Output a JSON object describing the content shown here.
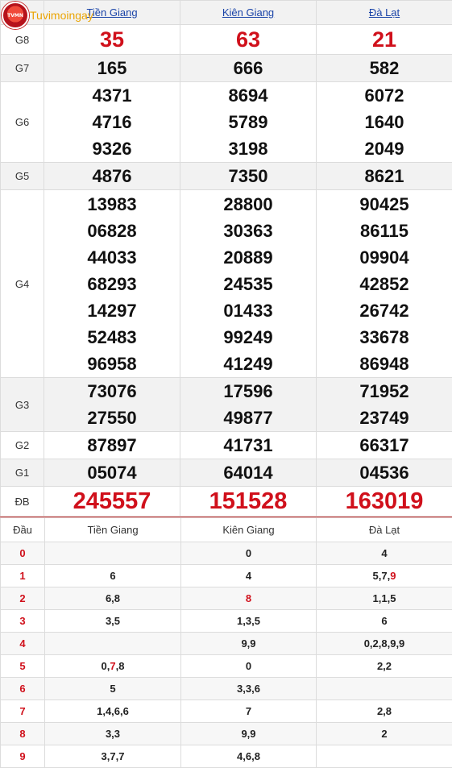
{
  "logo": {
    "text": "Tuvimoingay",
    "badge": "TVMN"
  },
  "results": {
    "provinces": [
      "Tiền Giang",
      "Kiên Giang",
      "Đà Lạt"
    ],
    "rows": [
      {
        "label": "G8",
        "values": [
          [
            "35"
          ],
          [
            "63"
          ],
          [
            "21"
          ]
        ]
      },
      {
        "label": "G7",
        "values": [
          [
            "165"
          ],
          [
            "666"
          ],
          [
            "582"
          ]
        ]
      },
      {
        "label": "G6",
        "values": [
          [
            "4371",
            "4716",
            "9326"
          ],
          [
            "8694",
            "5789",
            "3198"
          ],
          [
            "6072",
            "1640",
            "2049"
          ]
        ]
      },
      {
        "label": "G5",
        "values": [
          [
            "4876"
          ],
          [
            "7350"
          ],
          [
            "8621"
          ]
        ]
      },
      {
        "label": "G4",
        "values": [
          [
            "13983",
            "06828",
            "44033",
            "68293",
            "14297",
            "52483",
            "96958"
          ],
          [
            "28800",
            "30363",
            "20889",
            "24535",
            "01433",
            "99249",
            "41249"
          ],
          [
            "90425",
            "86115",
            "09904",
            "42852",
            "26742",
            "33678",
            "86948"
          ]
        ]
      },
      {
        "label": "G3",
        "values": [
          [
            "73076",
            "27550"
          ],
          [
            "17596",
            "49877"
          ],
          [
            "71952",
            "23749"
          ]
        ]
      },
      {
        "label": "G2",
        "values": [
          [
            "87897"
          ],
          [
            "41731"
          ],
          [
            "66317"
          ]
        ]
      },
      {
        "label": "G1",
        "values": [
          [
            "05074"
          ],
          [
            "64014"
          ],
          [
            "04536"
          ]
        ]
      },
      {
        "label": "ĐB",
        "values": [
          [
            "245557"
          ],
          [
            "151528"
          ],
          [
            "163019"
          ]
        ]
      }
    ]
  },
  "loto": {
    "header": [
      "Đầu",
      "Tiền Giang",
      "Kiên Giang",
      "Đà Lạt"
    ],
    "rows": [
      {
        "dau": "0",
        "cols": [
          [],
          [
            [
              "0",
              false
            ]
          ],
          [
            [
              "4",
              false
            ]
          ]
        ]
      },
      {
        "dau": "1",
        "cols": [
          [
            [
              "6",
              false
            ]
          ],
          [
            [
              "4",
              false
            ]
          ],
          [
            [
              "5",
              false
            ],
            [
              ",",
              false
            ],
            [
              "7",
              false
            ],
            [
              ",",
              false
            ],
            [
              "9",
              true
            ]
          ]
        ]
      },
      {
        "dau": "2",
        "cols": [
          [
            [
              "6,8",
              false
            ]
          ],
          [
            [
              "8",
              true
            ]
          ],
          [
            [
              "1,1,5",
              false
            ]
          ]
        ]
      },
      {
        "dau": "3",
        "cols": [
          [
            [
              "3,5",
              false
            ]
          ],
          [
            [
              "1,3,5",
              false
            ]
          ],
          [
            [
              "6",
              false
            ]
          ]
        ]
      },
      {
        "dau": "4",
        "cols": [
          [],
          [
            [
              "9,9",
              false
            ]
          ],
          [
            [
              "0,2,8,9,9",
              false
            ]
          ]
        ]
      },
      {
        "dau": "5",
        "cols": [
          [
            [
              "0,",
              false
            ],
            [
              "7",
              true
            ],
            [
              ",8",
              false
            ]
          ],
          [
            [
              "0",
              false
            ]
          ],
          [
            [
              "2,2",
              false
            ]
          ]
        ]
      },
      {
        "dau": "6",
        "cols": [
          [
            [
              "5",
              false
            ]
          ],
          [
            [
              "3,3,6",
              false
            ]
          ],
          []
        ]
      },
      {
        "dau": "7",
        "cols": [
          [
            [
              "1,4,6,6",
              false
            ]
          ],
          [
            [
              "7",
              false
            ]
          ],
          [
            [
              "2,8",
              false
            ]
          ]
        ]
      },
      {
        "dau": "8",
        "cols": [
          [
            [
              "3,3",
              false
            ]
          ],
          [
            [
              "9,9",
              false
            ]
          ],
          [
            [
              "2",
              false
            ]
          ]
        ]
      },
      {
        "dau": "9",
        "cols": [
          [
            [
              "3,7,7",
              false
            ]
          ],
          [
            [
              "4,6,8",
              false
            ]
          ],
          []
        ]
      }
    ]
  }
}
